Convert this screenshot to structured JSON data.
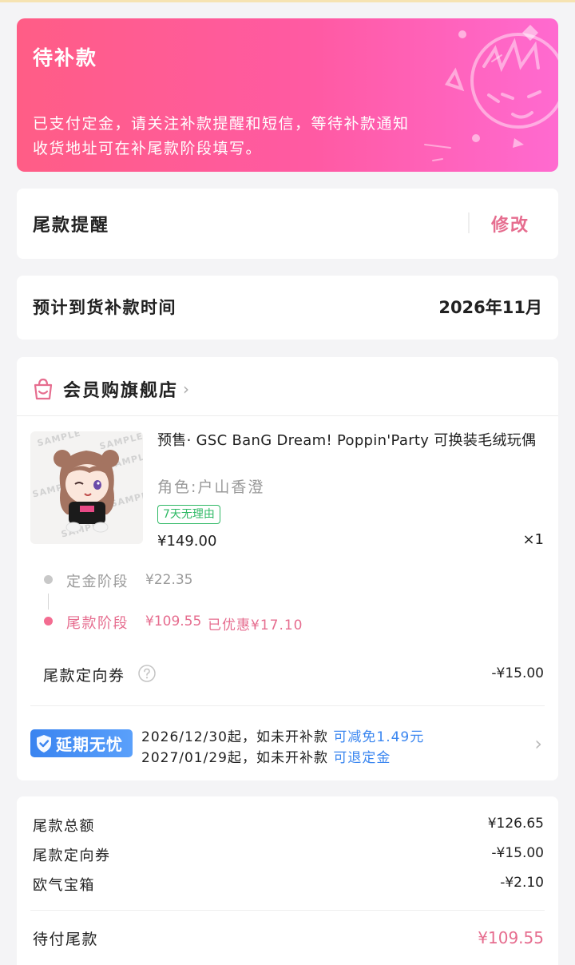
{
  "banner": {
    "title": "待补款",
    "desc_line1": "已支付定金，请关注补款提醒和短信，等待补款通知",
    "desc_line2": "收货地址可在补尾款阶段填写。"
  },
  "reminder": {
    "label": "尾款提醒",
    "edit_label": "修改"
  },
  "arrival": {
    "label": "预计到货补款时间",
    "value": "2026年11月"
  },
  "shop": {
    "name": "会员购旗舰店",
    "chevron": "›"
  },
  "product": {
    "image_watermark": "SAMPLE",
    "title": "预售· GSC BanG Dream! Poppin'Party 可换装毛绒玩偶",
    "variant": "角色:户山香澄",
    "tag": "7天无理由",
    "price": "¥149.00",
    "qty": "×1"
  },
  "stages": {
    "deposit": {
      "label": "定金阶段",
      "amount": "¥22.35"
    },
    "final": {
      "label": "尾款阶段",
      "amount": "¥109.55",
      "discount": "已优惠¥17.10"
    }
  },
  "coupon": {
    "label": "尾款定向券",
    "value": "-¥15.00"
  },
  "delay": {
    "badge": "延期无忧",
    "line1_text": "2026/12/30起，如未开补款",
    "line1_highlight": "可减免1.49元",
    "line2_text": "2027/01/29起，如未开补款",
    "line2_highlight": "可退定金",
    "chevron": "›"
  },
  "summary": {
    "rows": [
      {
        "label": "尾款总额",
        "value": "¥126.65"
      },
      {
        "label": "尾款定向券",
        "value": "-¥15.00"
      },
      {
        "label": "欧气宝箱",
        "value": "-¥2.10"
      }
    ],
    "total_label": "待付尾款",
    "total_value": "¥109.55"
  },
  "colors": {
    "accent_pink": "#e66d8f",
    "banner_gradient_start": "#ff5d86",
    "banner_gradient_end": "#ff6ad0",
    "tag_green": "#2fb965",
    "delay_blue": "#3a86f0"
  },
  "icons": {
    "shop": "shop-bag-icon",
    "help": "question-circle-icon",
    "delay": "shield-check-icon",
    "chevron": "chevron-right-icon"
  }
}
